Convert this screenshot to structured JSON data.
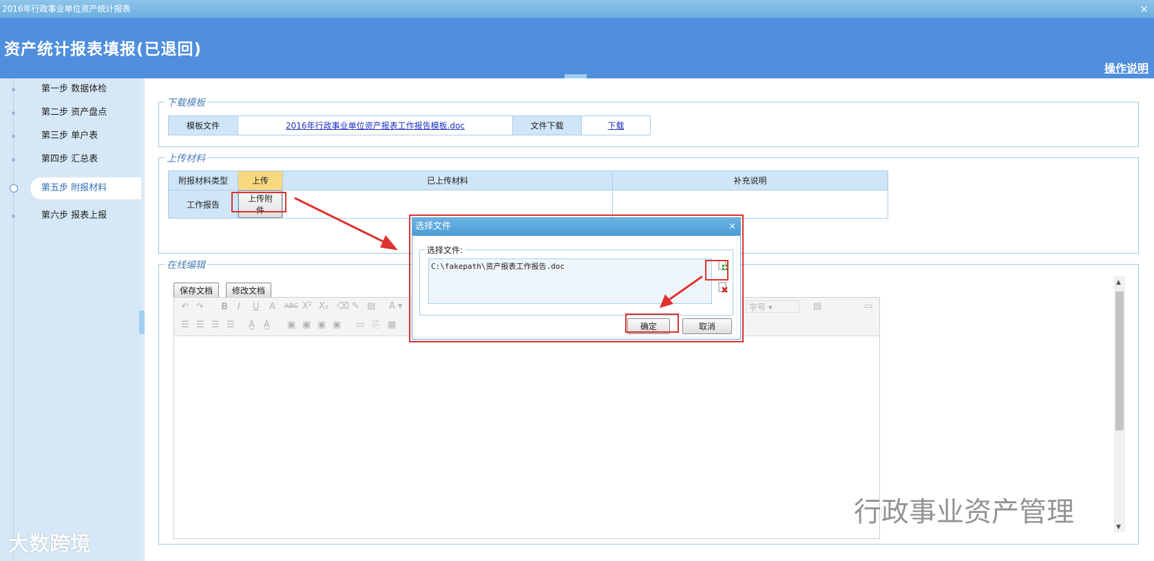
{
  "window": {
    "title": "2016年行政事业单位资产统计报表",
    "close_glyph": "×"
  },
  "header": {
    "title": "资产统计报表填报(已退回)",
    "help_link": "操作说明"
  },
  "sidebar": {
    "steps": [
      {
        "label": "第一步 数据体检"
      },
      {
        "label": "第二步 资产盘点"
      },
      {
        "label": "第三步 单户表"
      },
      {
        "label": "第四步 汇总表"
      },
      {
        "label": "第五步 附报材料",
        "active": true
      },
      {
        "label": "第六步 报表上报"
      }
    ]
  },
  "download_section": {
    "legend": "下载模板",
    "template_label": "模板文件",
    "template_file": "2016年行政事业单位资产报表工作报告模板.doc",
    "download_label": "文件下载",
    "download_link": "下载"
  },
  "upload_section": {
    "legend": "上传材料",
    "headers": [
      "附报材料类型",
      "上传",
      "已上传材料",
      "补充说明"
    ],
    "rows": [
      {
        "type": "工作报告",
        "button": "上传附件",
        "uploaded": "",
        "note": ""
      }
    ]
  },
  "editor_section": {
    "legend": "在线编辑",
    "save_button": "保存文档",
    "edit_button": "修改文档",
    "font_size_placeholder": "字号"
  },
  "dialog": {
    "title": "选择文件",
    "close_glyph": "×",
    "label": "选择文件:",
    "path": "C:\\fakepath\\资产报表工作报告.doc",
    "ok_button": "确定",
    "cancel_button": "取消"
  },
  "watermarks": {
    "left": "大数跨境",
    "right": "行政事业资产管理"
  },
  "colors": {
    "header": "#4f8fde",
    "annotation_red": "#d9302c",
    "accent_orange": "#f8d97f"
  }
}
